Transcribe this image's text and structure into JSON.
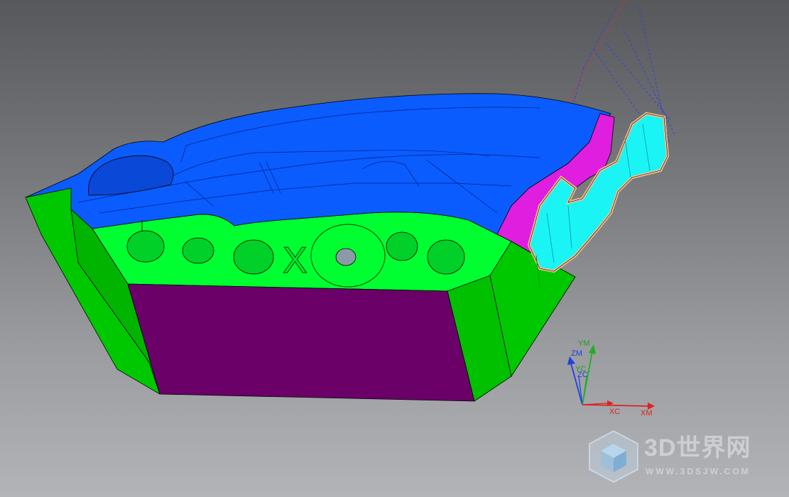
{
  "viewport": {
    "background_top": "#56585c",
    "background_bottom": "#b2b4b8"
  },
  "part_colors": {
    "top_surface": "#0a5cff",
    "side_wall": "#00c800",
    "core_insert": "#00ff30",
    "front_face": "#6a0068",
    "insert_magenta": "#e01ee0",
    "slider_cyan": "#1af4f4"
  },
  "triad": {
    "ym": "YM",
    "zm": "ZM",
    "yc": "YC",
    "zc": "ZC",
    "xc": "XC",
    "xm": "XM",
    "x_color": "#e02020",
    "y_color": "#20b020",
    "z_color": "#2040e0"
  },
  "engraving": {
    "letter": "X"
  },
  "watermark": {
    "title": "3D世界网",
    "url": "WWW.3DSJW.COM"
  }
}
